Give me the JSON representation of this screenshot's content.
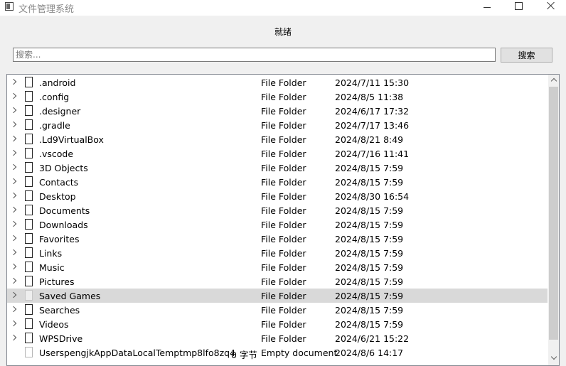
{
  "window": {
    "title": "文件管理系统"
  },
  "status": {
    "text": "就绪"
  },
  "search": {
    "placeholder": "搜索...",
    "value": "",
    "button_label": "搜索"
  },
  "tree": {
    "rows": [
      {
        "name": ".android",
        "size": "",
        "type": "File Folder",
        "date": "2024/7/11 15:30",
        "kind": "folder",
        "expandable": true,
        "selected": false
      },
      {
        "name": ".config",
        "size": "",
        "type": "File Folder",
        "date": "2024/8/5 11:38",
        "kind": "folder",
        "expandable": true,
        "selected": false
      },
      {
        "name": ".designer",
        "size": "",
        "type": "File Folder",
        "date": "2024/6/17 17:32",
        "kind": "folder",
        "expandable": true,
        "selected": false
      },
      {
        "name": ".gradle",
        "size": "",
        "type": "File Folder",
        "date": "2024/7/17 13:46",
        "kind": "folder",
        "expandable": true,
        "selected": false
      },
      {
        "name": ".Ld9VirtualBox",
        "size": "",
        "type": "File Folder",
        "date": "2024/8/21 8:49",
        "kind": "folder",
        "expandable": true,
        "selected": false
      },
      {
        "name": ".vscode",
        "size": "",
        "type": "File Folder",
        "date": "2024/7/16 11:41",
        "kind": "folder",
        "expandable": true,
        "selected": false
      },
      {
        "name": "3D Objects",
        "size": "",
        "type": "File Folder",
        "date": "2024/8/15 7:59",
        "kind": "folder",
        "expandable": true,
        "selected": false
      },
      {
        "name": "Contacts",
        "size": "",
        "type": "File Folder",
        "date": "2024/8/15 7:59",
        "kind": "folder",
        "expandable": true,
        "selected": false
      },
      {
        "name": "Desktop",
        "size": "",
        "type": "File Folder",
        "date": "2024/8/30 16:54",
        "kind": "folder",
        "expandable": true,
        "selected": false
      },
      {
        "name": "Documents",
        "size": "",
        "type": "File Folder",
        "date": "2024/8/15 7:59",
        "kind": "folder",
        "expandable": true,
        "selected": false
      },
      {
        "name": "Downloads",
        "size": "",
        "type": "File Folder",
        "date": "2024/8/15 7:59",
        "kind": "folder",
        "expandable": true,
        "selected": false
      },
      {
        "name": "Favorites",
        "size": "",
        "type": "File Folder",
        "date": "2024/8/15 7:59",
        "kind": "folder",
        "expandable": true,
        "selected": false
      },
      {
        "name": "Links",
        "size": "",
        "type": "File Folder",
        "date": "2024/8/15 7:59",
        "kind": "folder",
        "expandable": true,
        "selected": false
      },
      {
        "name": "Music",
        "size": "",
        "type": "File Folder",
        "date": "2024/8/15 7:59",
        "kind": "folder",
        "expandable": true,
        "selected": false
      },
      {
        "name": "Pictures",
        "size": "",
        "type": "File Folder",
        "date": "2024/8/15 7:59",
        "kind": "folder",
        "expandable": true,
        "selected": false
      },
      {
        "name": "Saved Games",
        "size": "",
        "type": "File Folder",
        "date": "2024/8/15 7:59",
        "kind": "folder",
        "expandable": true,
        "selected": true
      },
      {
        "name": "Searches",
        "size": "",
        "type": "File Folder",
        "date": "2024/8/15 7:59",
        "kind": "folder",
        "expandable": true,
        "selected": false
      },
      {
        "name": "Videos",
        "size": "",
        "type": "File Folder",
        "date": "2024/8/15 7:59",
        "kind": "folder",
        "expandable": true,
        "selected": false
      },
      {
        "name": "WPSDrive",
        "size": "",
        "type": "File Folder",
        "date": "2024/6/21 15:22",
        "kind": "folder",
        "expandable": true,
        "selected": false
      },
      {
        "name": "UserspengjkAppDataLocalTemptmp8lfo8zq4",
        "size": "0 字节",
        "type": "Empty document",
        "date": "2024/8/6 14:17",
        "kind": "document",
        "expandable": false,
        "selected": false
      }
    ]
  }
}
